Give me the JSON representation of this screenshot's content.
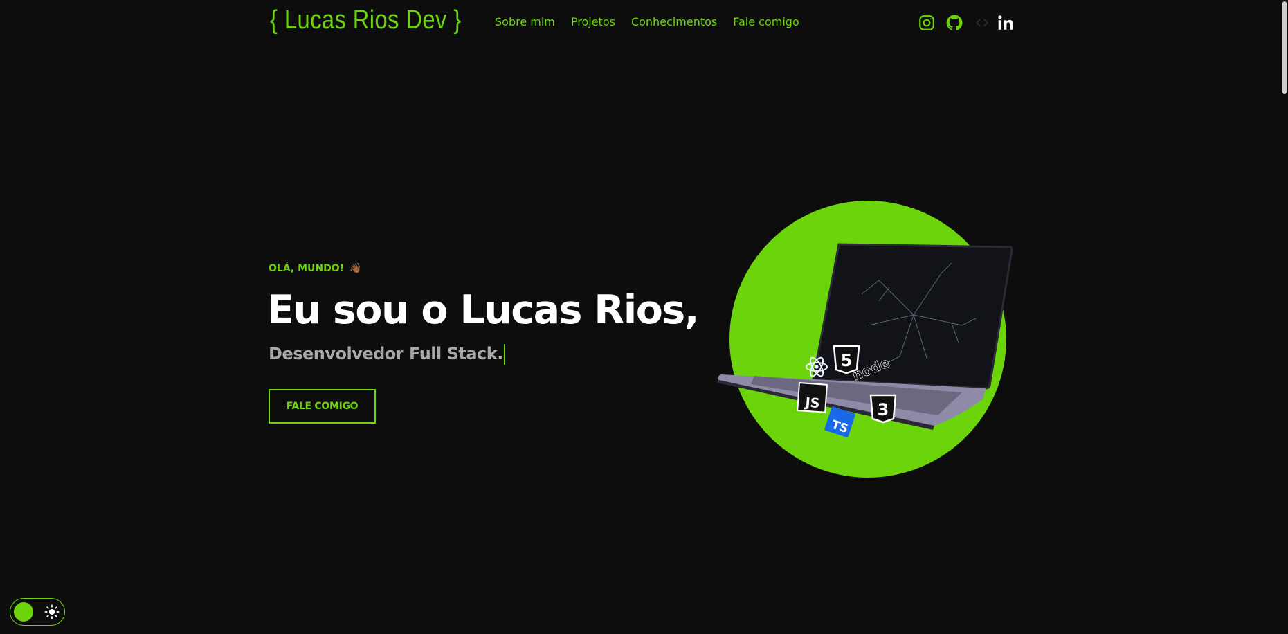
{
  "header": {
    "logo": "{ Lucas Rios Dev }",
    "nav": [
      {
        "label": "Sobre mim"
      },
      {
        "label": "Projetos"
      },
      {
        "label": "Conhecimentos"
      },
      {
        "label": "Fale comigo"
      }
    ],
    "socials": [
      "instagram-icon",
      "github-icon",
      "code-icon",
      "linkedin-icon"
    ]
  },
  "hero": {
    "greeting": "OLÁ, MUNDO!",
    "greeting_emoji": "👋🏾",
    "title": "Eu sou o Lucas Rios,",
    "subtitle": "Desenvolvedor Full Stack.",
    "cta_label": "FALE COMIGO",
    "tech_icons": [
      "react-icon",
      "html5-icon",
      "nodejs-icon",
      "javascript-icon",
      "css3-icon",
      "typescript-icon"
    ]
  },
  "theme_toggle": {
    "icon": "sun-icon"
  },
  "colors": {
    "accent": "#6cd40a",
    "background": "#0d0d0d",
    "text": "#ffffff",
    "muted_text": "#a8a8a8"
  }
}
